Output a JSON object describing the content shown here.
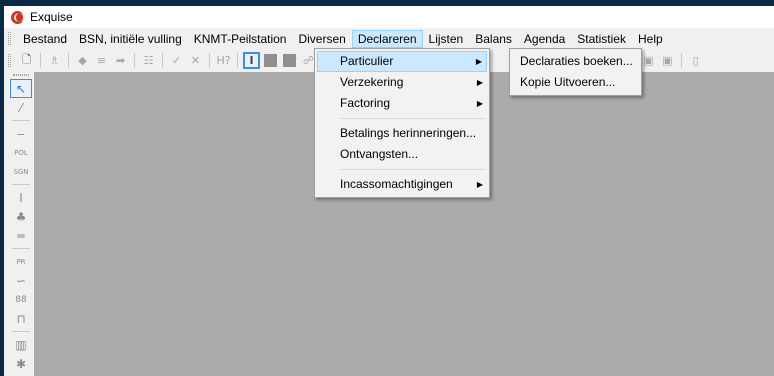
{
  "window": {
    "title": "Exquise"
  },
  "menubar": {
    "items": [
      {
        "label": "Bestand"
      },
      {
        "label": "BSN, initiële vulling"
      },
      {
        "label": "KNMT-Peilstation"
      },
      {
        "label": "Diversen"
      },
      {
        "label": "Declareren",
        "active": true
      },
      {
        "label": "Lijsten"
      },
      {
        "label": "Balans"
      },
      {
        "label": "Agenda"
      },
      {
        "label": "Statistiek"
      },
      {
        "label": "Help"
      }
    ]
  },
  "declareren_menu": {
    "items": [
      {
        "label": "Particulier",
        "submenu": true,
        "highlighted": true
      },
      {
        "label": "Verzekering",
        "submenu": true
      },
      {
        "label": "Factoring",
        "submenu": true
      },
      {
        "label": "Betalings herinneringen..."
      },
      {
        "label": "Ontvangsten..."
      },
      {
        "label": "Incassomachtigingen",
        "submenu": true
      }
    ]
  },
  "particulier_submenu": {
    "items": [
      {
        "label": "Declaraties boeken..."
      },
      {
        "label": "Kopie Uitvoeren..."
      }
    ]
  },
  "toolbar": {
    "icons": [
      "new-document-icon",
      "person-icon",
      "arrow-left-icon",
      "list-icon",
      "arrow-right-icon",
      "stack-icon",
      "checkmark-icon",
      "cross-icon",
      "help-query-icon",
      "text-cursor-icon",
      "block-icon",
      "block-icon",
      "camera-icon",
      "camera-icon",
      "copy-icon"
    ],
    "help_label": "H?",
    "text_label": "I"
  },
  "sidetool": {
    "icons": [
      "pointer-icon",
      "brush-icon",
      "drill-icon",
      "pol-icon",
      "sgn-icon",
      "implant-icon",
      "tooth-icon",
      "bridge-icon",
      "pr-icon",
      "curve-icon",
      "pair-icon",
      "crown-icon",
      "bin-icon",
      "gear-icon"
    ],
    "labels": {
      "pol": "POL",
      "sgn": "SGN",
      "pr": "PR",
      "pair": "88"
    }
  },
  "colors": {
    "workspace": "#ababab",
    "menu_highlight": "#cce8ff",
    "outer_border": "#0b2a47",
    "app_icon": "#c43b22"
  }
}
